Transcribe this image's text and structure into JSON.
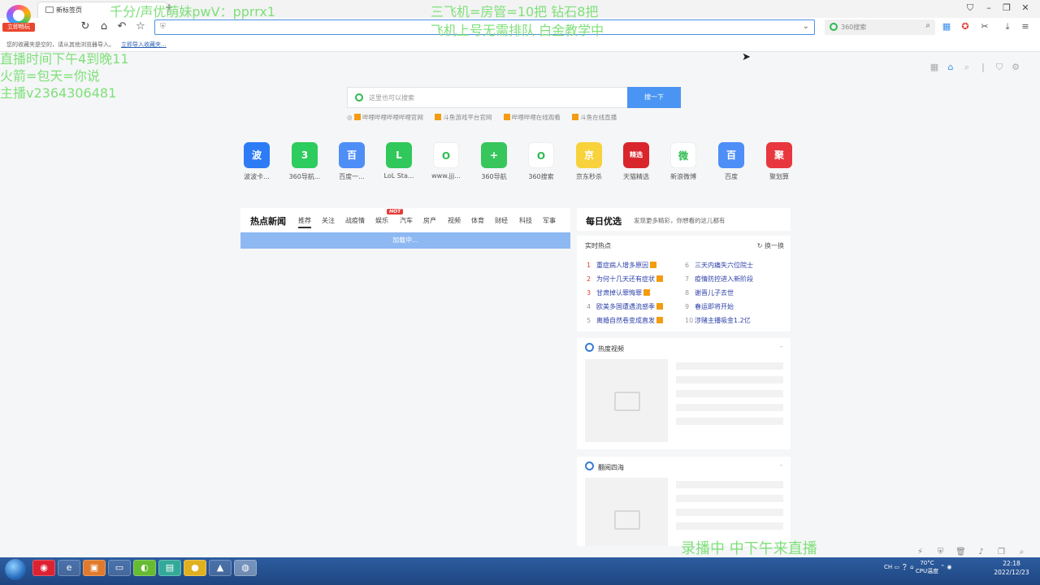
{
  "browser": {
    "tab_title": "新标签页",
    "new_tab_symbol": "+",
    "logo_badge": "立即畅玩",
    "search_placeholder": "360搜索",
    "bookmark_notice": "您的收藏夹是空的，请从其他浏览器导入。",
    "bookmark_import_link": "立即导入收藏夹..."
  },
  "overlays": {
    "top_left": "千分/声优萌妹pwV：pprrx1",
    "top_right_1": "三飞机=房管=10把 钻石8把",
    "top_right_2": "飞机上号无需排队 白金教学中",
    "left_1": "直播时间下午4到晚11",
    "left_2": "火箭=包天=你说",
    "left_3": "主播v2364306481",
    "bottom": "录播中 中下午来直播"
  },
  "main_search": {
    "placeholder": "这里也可以搜索",
    "button": "搜一下"
  },
  "hot_links": [
    "哔哩哔哩哔哩哔哩官网",
    "斗鱼游戏平台官网",
    "哔哩哔哩在线观看",
    "斗鱼在线直播"
  ],
  "sites": [
    {
      "label": "波波卡...",
      "icon_text": "波",
      "color": "#2d7cf6"
    },
    {
      "label": "360导航...",
      "icon_text": "3",
      "color": "#2dcc5e"
    },
    {
      "label": "百度一...",
      "icon_text": "百",
      "color": "#4e8ef7"
    },
    {
      "label": "LoL Sta...",
      "icon_text": "L",
      "color": "#30c85a"
    },
    {
      "label": "www.jjj...",
      "icon_text": "O",
      "color": "#ffffff"
    },
    {
      "label": "360导航",
      "icon_text": "+",
      "color": "#37c65c"
    },
    {
      "label": "360搜索",
      "icon_text": "O",
      "color": "#ffffff"
    },
    {
      "label": "京东秒杀",
      "icon_text": "京",
      "color": "#f7d23b"
    },
    {
      "label": "天猫精选",
      "icon_text": "精选",
      "color": "#d9262c"
    },
    {
      "label": "新浪微博",
      "icon_text": "微",
      "color": "#ffffff"
    },
    {
      "label": "百度",
      "icon_text": "百",
      "color": "#4e8ef7"
    },
    {
      "label": "聚划算",
      "icon_text": "聚",
      "color": "#e8373e"
    }
  ],
  "news": {
    "title": "热点新闻",
    "tabs": [
      "推荐",
      "关注",
      "战疫情",
      "娱乐",
      "汽车",
      "房产",
      "视频",
      "体育",
      "财经",
      "科技",
      "军事"
    ],
    "hot_badge": "HOT",
    "loading": "加载中..."
  },
  "daily": {
    "title": "每日优选",
    "subtitle": "发现更多精彩，你想看的这儿都有"
  },
  "hot_topics": {
    "title": "实时热点",
    "refresh": "换一换",
    "items": [
      {
        "rank": "1",
        "text": "重症病人增多原因"
      },
      {
        "rank": "2",
        "text": "为何十几天还有症状"
      },
      {
        "rank": "3",
        "text": "甘肃掉认罪悔罪"
      },
      {
        "rank": "4",
        "text": "欧美多国遭遇流感季"
      },
      {
        "rank": "5",
        "text": "离婚自然卷变成直发"
      },
      {
        "rank": "6",
        "text": "三天内痛失六位院士"
      },
      {
        "rank": "7",
        "text": "疫情防控进入新阶段"
      },
      {
        "rank": "8",
        "text": "谢晋儿子去世"
      },
      {
        "rank": "9",
        "text": "春运即将开始"
      },
      {
        "rank": "10",
        "text": "涉赌主播吸金1.2亿"
      }
    ]
  },
  "cards": [
    {
      "title": "热度视频",
      "arrow": "-"
    },
    {
      "title": "翻阅四海",
      "arrow": "-"
    }
  ],
  "taskbar": {
    "lang": "CH",
    "temp": "70°C",
    "cpu": "CPU温度",
    "time": "22:18",
    "date": "2022/12/23"
  }
}
